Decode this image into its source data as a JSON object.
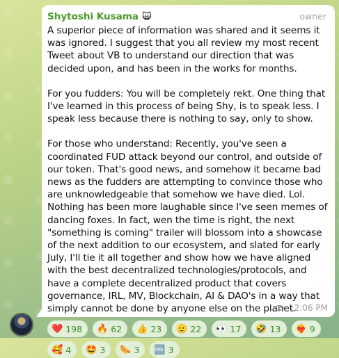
{
  "message": {
    "sender": "Shytoshi Kusama",
    "sender_emoji": "🙀",
    "role": "owner",
    "paragraphs": [
      "A superior piece of information was shared and it seems it was ignored. I suggest that you all review my most recent Tweet about VB to understand our direction that was decided upon, and has been in the works for months.",
      "For you fudders: You will be completely rekt. One thing that I've learned in this process of being Shy, is to speak less. I speak less because there is nothing to say, only to show.",
      "For those who understand: Recently, you've seen a coordinated FUD attack beyond our control, and outside of our token. That's good news, and somehow it became bad news as the fudders are attempting to convince those who are unknowledgeable that somehow we have died. Lol. Nothing has been more laughable since I've seen memes of dancing foxes. In fact, wen the time is right, the next \"something is coming\" trailer will blossom into a showcase of the next addition to our ecosystem, and slated for early July, I'll tie it all together and show how we have aligned with the best decentralized technologies/protocols, and have a complete decentralized product that covers governance, IRL, MV, Blockchain, AI & DAO's in a way that simply cannot be done by anyone else on the planet."
    ],
    "reactions": [
      {
        "emoji": "❤️",
        "count": "198"
      },
      {
        "emoji": "🔥",
        "count": "62"
      },
      {
        "emoji": "👍",
        "count": "23"
      },
      {
        "emoji": "🫡",
        "count": "22"
      },
      {
        "emoji": "👀",
        "count": "17"
      },
      {
        "emoji": "🤣",
        "count": "13"
      },
      {
        "emoji": "❤️‍🔥",
        "count": "9"
      },
      {
        "emoji": "🥰",
        "count": "4"
      },
      {
        "emoji": "🤩",
        "count": "3"
      },
      {
        "emoji": "🌭",
        "count": "3"
      },
      {
        "emoji": "🆒",
        "count": "3"
      }
    ],
    "views_icon": "eye-icon",
    "time": "12:06 PM"
  }
}
